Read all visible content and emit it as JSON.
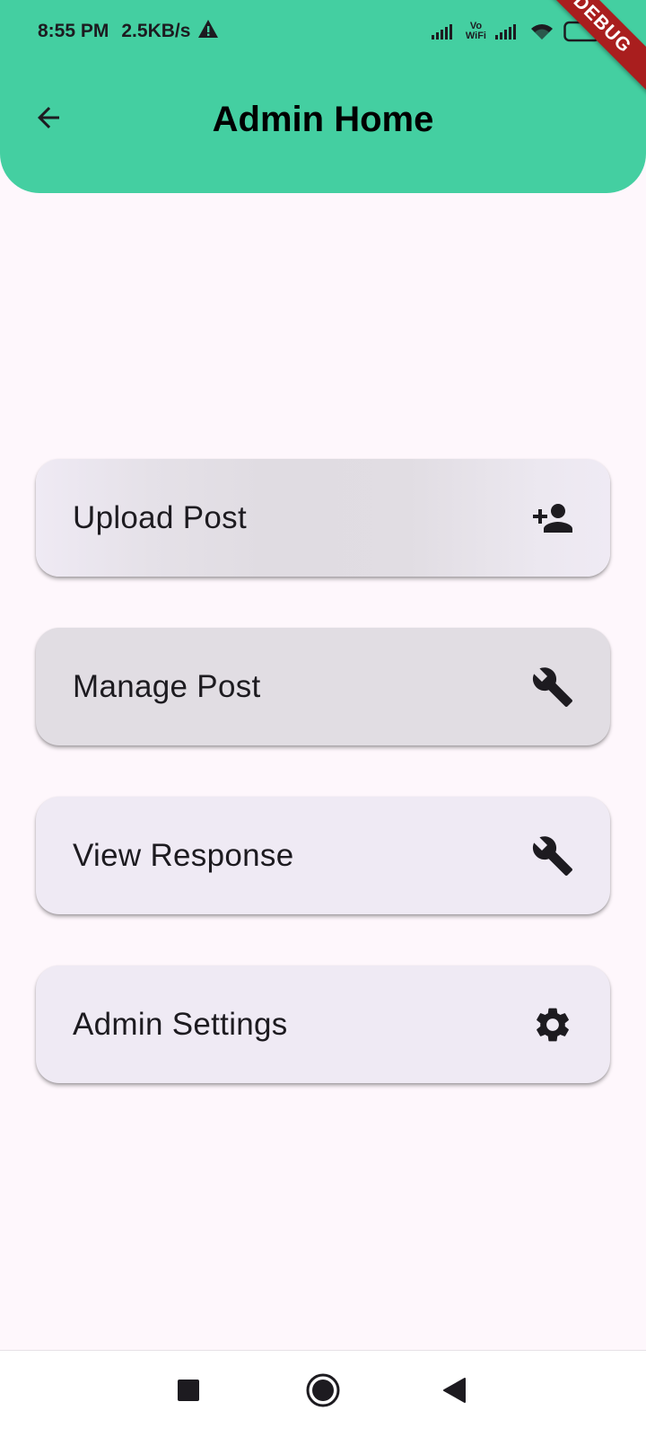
{
  "colors": {
    "app_bar": "#44cfa1",
    "background": "#fef7fc",
    "card": "#efeaf4",
    "card_pressed": "#e1dde3",
    "debug_banner": "#a91e1e"
  },
  "status_bar": {
    "time": "8:55 PM",
    "speed": "2.5KB/s",
    "alert_icon": "warning-icon",
    "vowifi_top": "Vo",
    "vowifi_bottom": "WiFi"
  },
  "app_bar": {
    "title": "Admin Home",
    "back_icon": "arrow-back-icon"
  },
  "debug_banner": "DEBUG",
  "menu": {
    "items": [
      {
        "label": "Upload Post",
        "icon": "person-add-icon"
      },
      {
        "label": "Manage Post",
        "icon": "wrench-icon"
      },
      {
        "label": "View Response",
        "icon": "wrench-icon"
      },
      {
        "label": "Admin Settings",
        "icon": "gear-icon"
      }
    ]
  },
  "nav_bar": {
    "recents_icon": "square-icon",
    "home_icon": "circle-icon",
    "back_icon": "triangle-back-icon"
  }
}
